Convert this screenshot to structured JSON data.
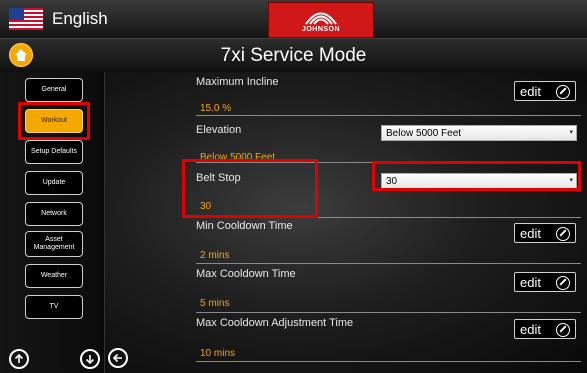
{
  "header": {
    "language": "English",
    "brand": "JOHNSON"
  },
  "title_bar": {
    "title": "7xi Service Mode"
  },
  "sidebar": {
    "items": [
      {
        "label": "General"
      },
      {
        "label": "Workout",
        "active": true
      },
      {
        "label": "Setup Defaults"
      },
      {
        "label": "Update"
      },
      {
        "label": "Network"
      },
      {
        "label": "Asset Management"
      },
      {
        "label": "Weather"
      },
      {
        "label": "TV"
      }
    ]
  },
  "settings": {
    "maximum_incline": {
      "label": "Maximum Incline",
      "value": "15.0 %",
      "button": "edit"
    },
    "elevation": {
      "label": "Elevation",
      "value": "Below 5000 Feet",
      "selected": "Below 5000 Feet"
    },
    "belt_stop": {
      "label": "Belt Stop",
      "value": "30",
      "selected": "30"
    },
    "min_cooldown": {
      "label": "Min Cooldown Time",
      "value": "2 mins",
      "button": "edit"
    },
    "max_cooldown": {
      "label": "Max Cooldown Time",
      "value": "5 mins",
      "button": "edit"
    },
    "max_cooldown_adjust": {
      "label": "Max Cooldown Adjustment Time",
      "value": "10 mins",
      "button": "edit"
    }
  },
  "icons": {
    "home": "home-icon",
    "scroll_up": "arrow-up-circle-icon",
    "scroll_down": "arrow-down-circle-icon",
    "back": "arrow-left-circle-icon",
    "edit": "pencil-circle-icon"
  },
  "colors": {
    "accent": "#f5a800",
    "highlight": "#e00000",
    "brand_red": "#d01818"
  }
}
